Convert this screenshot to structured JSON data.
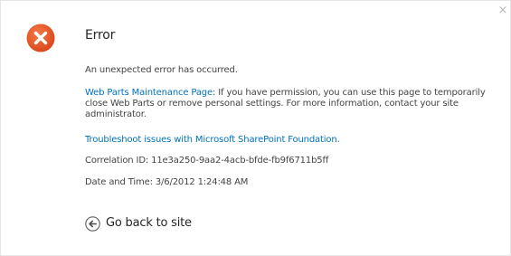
{
  "dialog": {
    "close_glyph": "×",
    "title": "Error",
    "icon": "error-icon",
    "accent_color": "#e04f1a",
    "link_color": "#0072bc"
  },
  "message": {
    "unexpected": "An unexpected error has occurred.",
    "web_parts_link": "Web Parts Maintenance Page",
    "web_parts_text": ": If you have permission, you can use this page to temporarily close Web Parts or remove personal settings. For more information, contact your site administrator.",
    "troubleshoot_link": "Troubleshoot issues with Microsoft SharePoint Foundation.",
    "correlation": "Correlation ID: 11e3a250-9aa2-4acb-bfde-fb9f6711b5ff",
    "datetime": "Date and Time: 3/6/2012 1:24:48 AM"
  },
  "footer": {
    "back_label": "Go back to site",
    "back_icon": "arrow-left-circle-icon"
  }
}
